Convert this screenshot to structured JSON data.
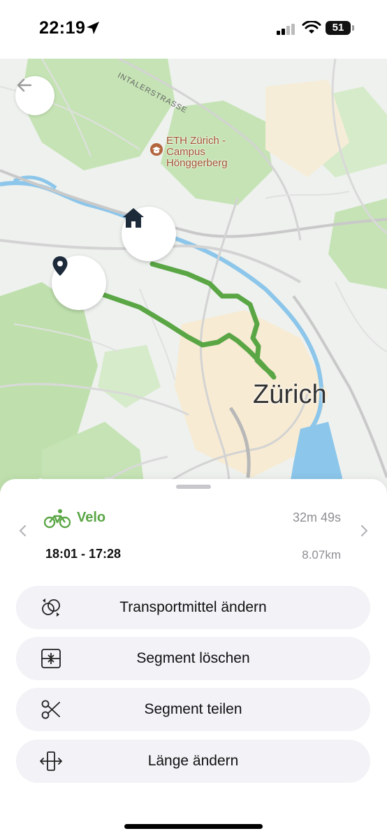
{
  "status_bar": {
    "time": "22:19",
    "battery_level": "51",
    "icons": [
      "location-arrow-icon",
      "signal-bars-icon",
      "wifi-icon",
      "battery-icon"
    ]
  },
  "map": {
    "city_label": "Zürich",
    "poi_label_line1": "ETH Zürich -",
    "poi_label_line2": "Campus",
    "poi_label_line3": "Hönggerberg",
    "street_label": "INTALERSTRASSE",
    "route_color": "#5aa645",
    "icons": [
      "back-arrow-icon",
      "home-icon",
      "map-pin-icon",
      "university-icon"
    ]
  },
  "segment": {
    "mode_label": "Velo",
    "mode_icon": "bicycle-icon",
    "duration": "32m 49s",
    "time_range": "18:01 - 17:28",
    "distance": "8.07km",
    "accent_color": "#5aa645"
  },
  "actions": [
    {
      "label": "Transportmittel ändern",
      "icon": "change-transport-icon"
    },
    {
      "label": "Segment löschen",
      "icon": "delete-segment-icon"
    },
    {
      "label": "Segment teilen",
      "icon": "scissors-icon"
    },
    {
      "label": "Länge ändern",
      "icon": "resize-length-icon"
    }
  ]
}
